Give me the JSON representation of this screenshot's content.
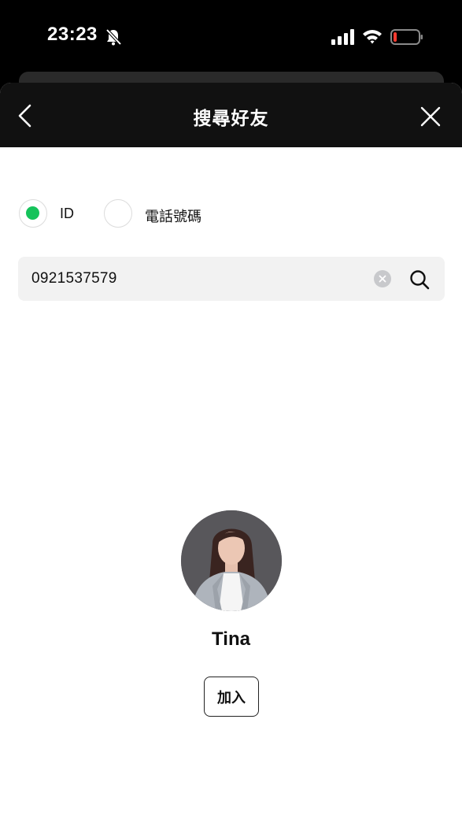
{
  "status_bar": {
    "time": "23:23",
    "icons": [
      "bell-slash-icon",
      "cellular-signal-icon",
      "wifi-icon",
      "battery-low-icon"
    ]
  },
  "header": {
    "title": "搜尋好友",
    "back_icon": "chevron-left-icon",
    "close_icon": "close-icon"
  },
  "search_type": {
    "options": [
      {
        "label": "ID",
        "selected": true
      },
      {
        "label": "電話號碼",
        "selected": false
      }
    ],
    "accent_color": "#16c35b"
  },
  "search": {
    "value": "0921537579",
    "clear_icon": "clear-circle-icon",
    "search_icon": "search-icon"
  },
  "result": {
    "name": "Tina",
    "add_label": "加入"
  }
}
